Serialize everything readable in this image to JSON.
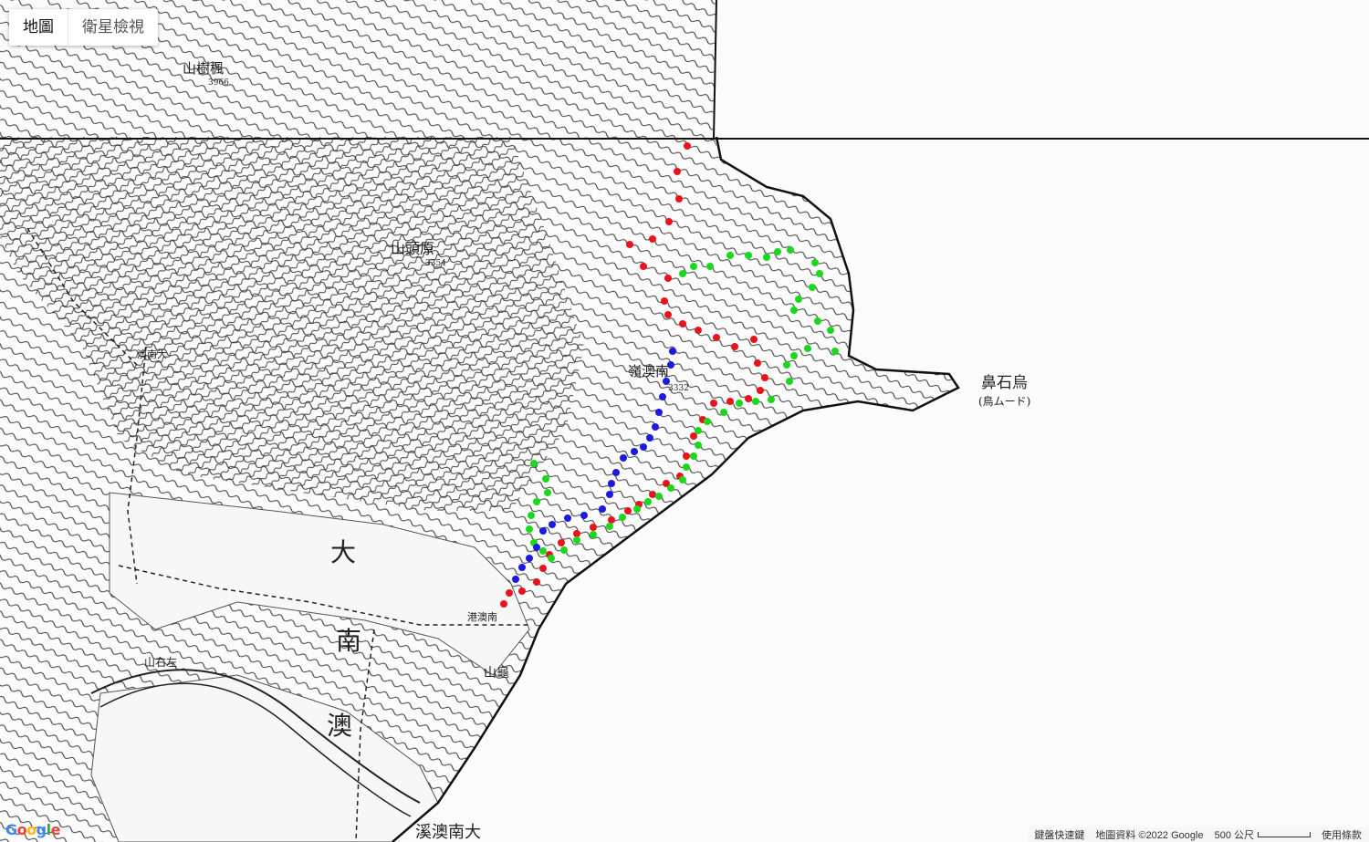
{
  "map_type_controls": {
    "map_label": "地圖",
    "satellite_label": "衛星檢視"
  },
  "map_labels": {
    "peak1": "山樹楓",
    "peak1_height": "3966",
    "peak2": "山頭原",
    "peak2_height": "3354",
    "cape": "鼻石烏",
    "cape_sub": "(鳥ムード)",
    "ridge": "嶺澳南",
    "ridge_height": "3332",
    "bay_char1": "大",
    "bay_char2": "南",
    "bay_char3": "澳",
    "river": "溪澳南大",
    "hill": "山龜",
    "hill2": "山右左",
    "small1": "澳南大",
    "small2": "港澳南"
  },
  "routes": {
    "red_color": "#e8131c",
    "green_color": "#1cd81c",
    "blue_color": "#1a1ae0"
  },
  "footer": {
    "shortcuts": "鍵盤快速鍵",
    "map_data": "地圖資料 ©2022 Google",
    "scale_label": "500 公尺",
    "terms": "使用條款"
  },
  "logo": [
    "G",
    "o",
    "o",
    "g",
    "l",
    "e"
  ]
}
